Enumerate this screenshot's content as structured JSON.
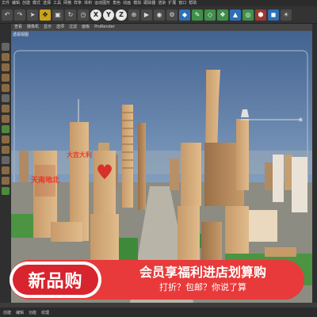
{
  "menubar": {
    "items": [
      "文件",
      "编辑",
      "创建",
      "模式",
      "选择",
      "工具",
      "网格",
      "样条",
      "体积",
      "运动图形",
      "角色",
      "动画",
      "模拟",
      "跟踪器",
      "渲染",
      "扩展",
      "窗口",
      "帮助"
    ]
  },
  "toolbar": {
    "axis_buttons": [
      "X",
      "Y",
      "Z"
    ]
  },
  "viewport": {
    "menu": [
      "查看",
      "摄像机",
      "显示",
      "选项",
      "过滤",
      "面板",
      "ProRender"
    ],
    "label": "透视视图"
  },
  "scene": {
    "sign_left": "天南地北",
    "sign_mid": "大吉大利"
  },
  "banner": {
    "badge": "新品购",
    "main": "会员享福利进店划算购",
    "sub": "打折？包邮？你说了算",
    "color": "#e83a3a"
  },
  "bottombar": {
    "items": [
      "创建",
      "编辑",
      "功能",
      "纹理"
    ]
  }
}
